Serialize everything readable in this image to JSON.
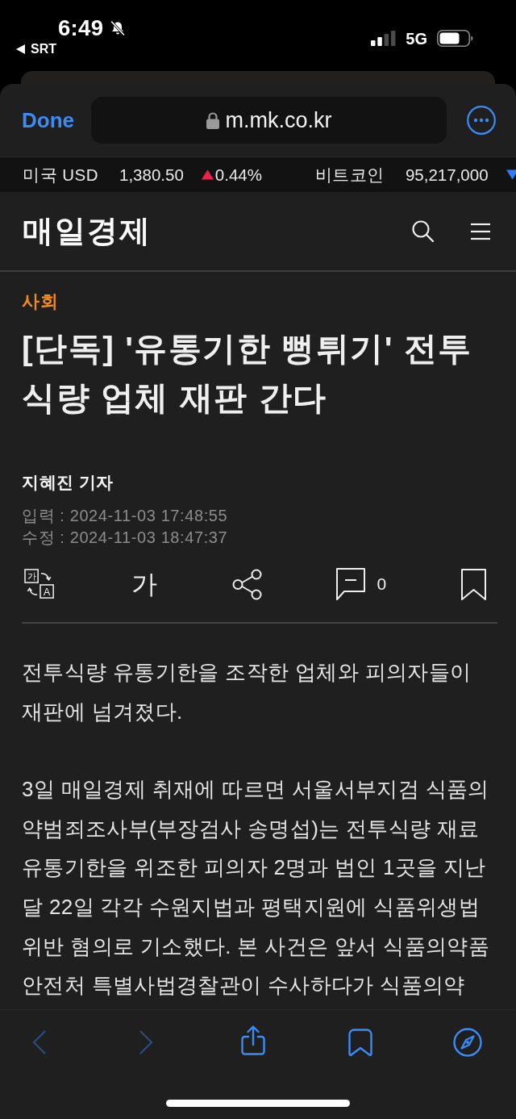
{
  "status_bar": {
    "time": "6:49",
    "silent": true,
    "back_app": "SRT",
    "network": "5G"
  },
  "browser_bar": {
    "done": "Done",
    "url": "m.mk.co.kr",
    "secure": true
  },
  "ticker": [
    {
      "name": "미국 USD",
      "value": "1,380.50",
      "change": "0.44%",
      "rising": true
    },
    {
      "name": "비트코인",
      "value": "95,217,000",
      "rising": false
    }
  ],
  "site_header": {
    "logo": "매일경제"
  },
  "article": {
    "category": "사회",
    "headline": "[단독] '유통기한 뻥튀기' 전투식량 업체 재판 간다",
    "author": "지혜진 기자",
    "dates": [
      "입력 : 2024-11-03 17:48:55",
      "수정 : 2024-11-03 18:47:37"
    ],
    "actions": {
      "translate": {
        "source": "가",
        "target": "A"
      },
      "font_size": "가",
      "comment_count": "0"
    },
    "paragraphs": [
      "전투식량 유통기한을 조작한 업체와 피의자들이 재판에 넘겨졌다.",
      "3일 매일경제 취재에 따르면 서울서부지검 식품의약범죄조사부(부장검사 송명섭)는 전투식량 재료 유통기한을 위조한 피의자 2명과 법인 1곳을 지난달 22일 각각 수원지법과 평택지원에 식품위생법 위반 혐의로 기소했다. 본 사건은 앞서 식품의약품안전처 특별사법경찰관이 수사하다가 식품의약"
    ]
  },
  "browser_toolbar": {
    "back": {
      "disabled": true
    },
    "forward": {
      "disabled": true
    }
  }
}
